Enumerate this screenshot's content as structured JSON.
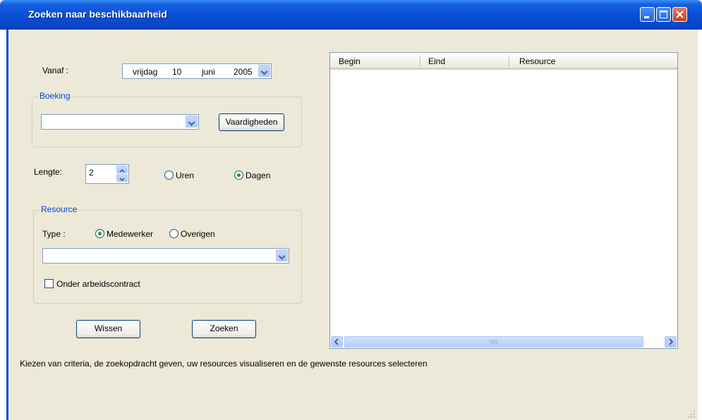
{
  "window": {
    "title": "Zoeken naar beschikbaarheid"
  },
  "vanaf": {
    "label": "Vanaf :",
    "day_name": "vrijdag",
    "day": "10",
    "month": "juni",
    "year": "2005"
  },
  "boeking": {
    "legend": "Boeking",
    "combo_value": "",
    "skills_button": "Vaardigheden"
  },
  "lengte": {
    "label": "Lengte:",
    "value": "2",
    "unit_options": [
      {
        "label": "Uren",
        "checked": false
      },
      {
        "label": "Dagen",
        "checked": true
      }
    ]
  },
  "resource": {
    "legend": "Resource",
    "type_label": "Type :",
    "type_options": [
      {
        "label": "Medewerker",
        "checked": true
      },
      {
        "label": "Overigen",
        "checked": false
      }
    ],
    "combo_value": "",
    "checkbox_label": "Onder arbeidscontract",
    "checkbox_checked": false
  },
  "buttons": {
    "clear": "Wissen",
    "search": "Zoeken"
  },
  "results": {
    "columns": [
      "Begin",
      "Eind",
      "Resource"
    ],
    "rows": []
  },
  "status_text": "Kiezen van criteria, de zoekopdracht geven, uw resources visualiseren en de gewenste resources selecteren",
  "colors": {
    "titlebar": "#0a4fd6",
    "client_bg": "#ece9d8",
    "legend_text": "#0046d5"
  }
}
